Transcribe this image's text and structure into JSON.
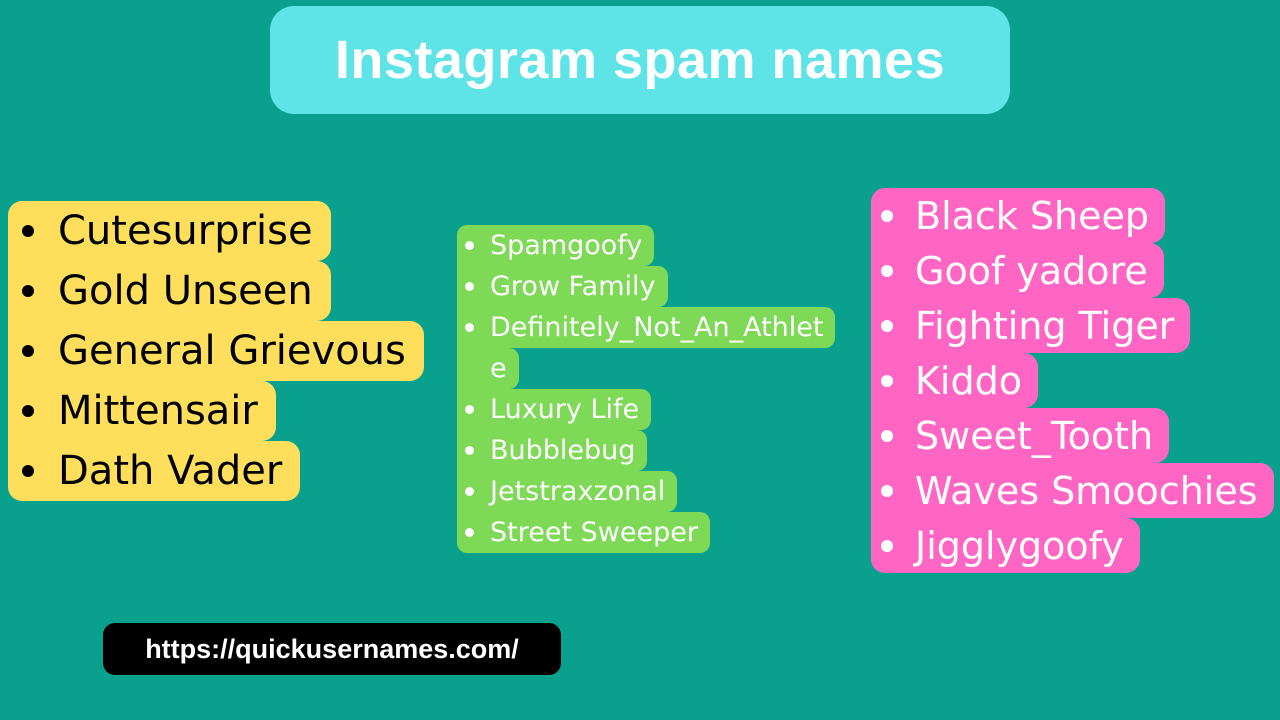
{
  "title": "Instagram spam names",
  "colors": {
    "background": "#0aa08e",
    "title_box": "#5ee3e6",
    "yellow": "#fede5b",
    "green": "#7ed957",
    "pink": "#ff66c4",
    "url_box": "#000000"
  },
  "lists": {
    "yellow": [
      "Cutesurprise",
      "Gold Unseen",
      "General Grievous",
      "Mittensair",
      "Dath Vader"
    ],
    "green": [
      "Spamgoofy",
      "Grow Family",
      "Definitely_Not_An_Athlet",
      "e",
      "Luxury Life",
      "Bubblebug",
      "Jetstraxzonal",
      "Street Sweeper"
    ],
    "pink": [
      "Black Sheep",
      "Goof yadore",
      "Fighting Tiger",
      "Kiddo",
      "Sweet_Tooth",
      "Waves Smoochies",
      "Jigglygoofy"
    ]
  },
  "url": "https://quickusernames.com/"
}
